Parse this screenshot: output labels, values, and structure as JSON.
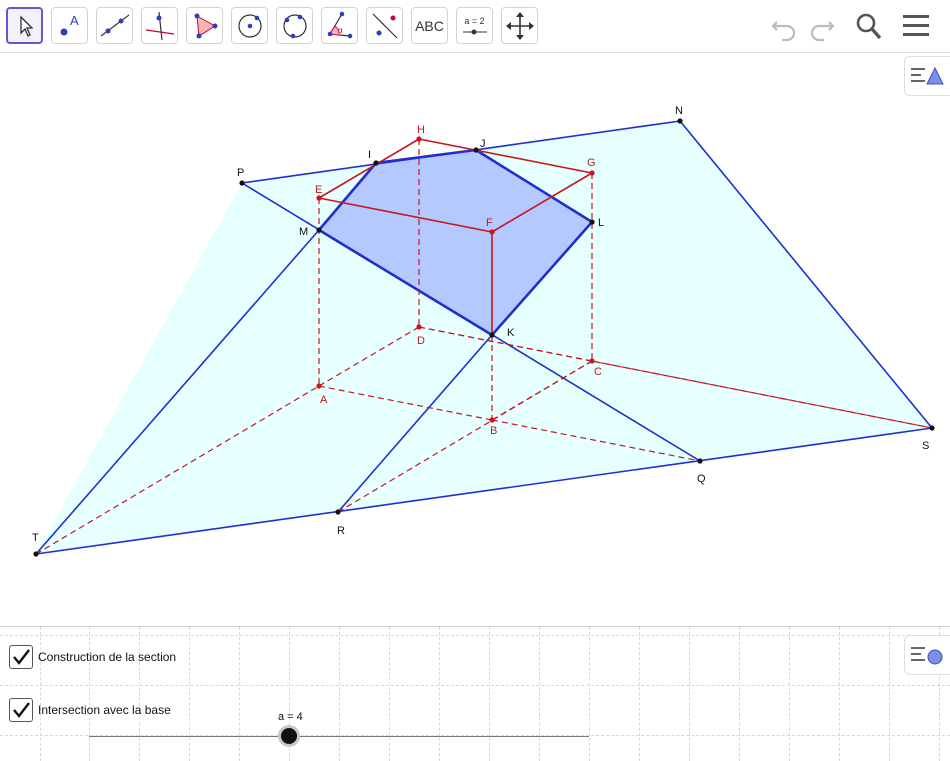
{
  "toolbar": {
    "tools": [
      "move-tool",
      "point-tool",
      "line-tool",
      "perpendicular-line-tool",
      "polygon-tool",
      "circle-tool",
      "conic-tool",
      "angle-tool",
      "reflect-tool",
      "text-tool",
      "slider-tool",
      "move-graphics-view-tool"
    ],
    "text_tool_label": "ABC",
    "slider_tool_label": "a = 2",
    "right_icons": [
      "undo-icon",
      "redo-icon",
      "search-icon",
      "menu-icon"
    ]
  },
  "points": {
    "N": "N",
    "H": "H",
    "J": "J",
    "I": "I",
    "G": "G",
    "P": "P",
    "E": "E",
    "F": "F",
    "L": "L",
    "M": "M",
    "K": "K",
    "D": "D",
    "C": "C",
    "A": "A",
    "B": "B",
    "S": "S",
    "Q": "Q",
    "T": "T",
    "R": "R"
  },
  "colors": {
    "plane_fill": "#e6ffff",
    "plane_edge": "#1f2fcf",
    "section_fill": "#b3c9ff",
    "prism_edge": "#c8161d"
  },
  "algebra": {
    "checkbox1_label": "Construction de la section",
    "checkbox1_checked": true,
    "checkbox2_label": "Intersection avec la base",
    "checkbox2_checked": true,
    "slider_label": "a = 4",
    "slider_value": 4
  }
}
